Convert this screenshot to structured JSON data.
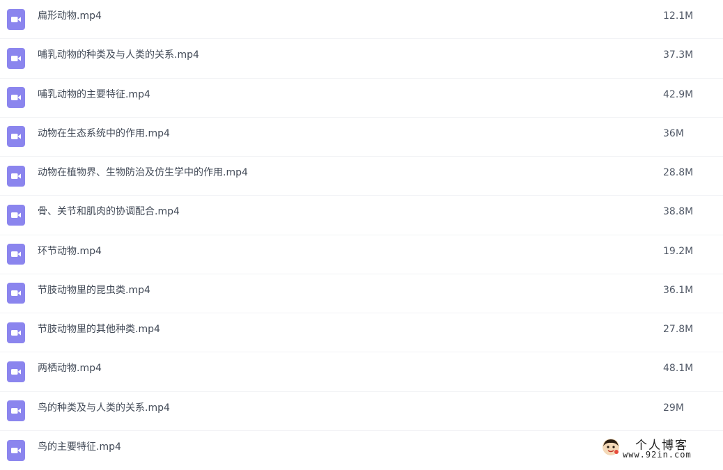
{
  "files": [
    {
      "name": "扁形动物.mp4",
      "size": "12.1M",
      "icon": "video-file-icon"
    },
    {
      "name": "哺乳动物的种类及与人类的关系.mp4",
      "size": "37.3M",
      "icon": "video-file-icon"
    },
    {
      "name": "哺乳动物的主要特征.mp4",
      "size": "42.9M",
      "icon": "video-file-icon"
    },
    {
      "name": "动物在生态系统中的作用.mp4",
      "size": "36M",
      "icon": "video-file-icon"
    },
    {
      "name": "动物在植物界、生物防治及仿生学中的作用.mp4",
      "size": "28.8M",
      "icon": "video-file-icon"
    },
    {
      "name": "骨、关节和肌肉的协调配合.mp4",
      "size": "38.8M",
      "icon": "video-file-icon"
    },
    {
      "name": "环节动物.mp4",
      "size": "19.2M",
      "icon": "video-file-icon"
    },
    {
      "name": "节肢动物里的昆虫类.mp4",
      "size": "36.1M",
      "icon": "video-file-icon"
    },
    {
      "name": "节肢动物里的其他种类.mp4",
      "size": "27.8M",
      "icon": "video-file-icon"
    },
    {
      "name": "两栖动物.mp4",
      "size": "48.1M",
      "icon": "video-file-icon"
    },
    {
      "name": "鸟的种类及与人类的关系.mp4",
      "size": "29M",
      "icon": "video-file-icon"
    },
    {
      "name": "鸟的主要特征.mp4",
      "size": "",
      "icon": "video-file-icon"
    }
  ],
  "watermark": {
    "title": "个人博客",
    "url": "www.92in.com"
  },
  "colors": {
    "icon_background": "#8b85ee",
    "row_divider": "#f1f2f5",
    "text": "#424a57"
  }
}
